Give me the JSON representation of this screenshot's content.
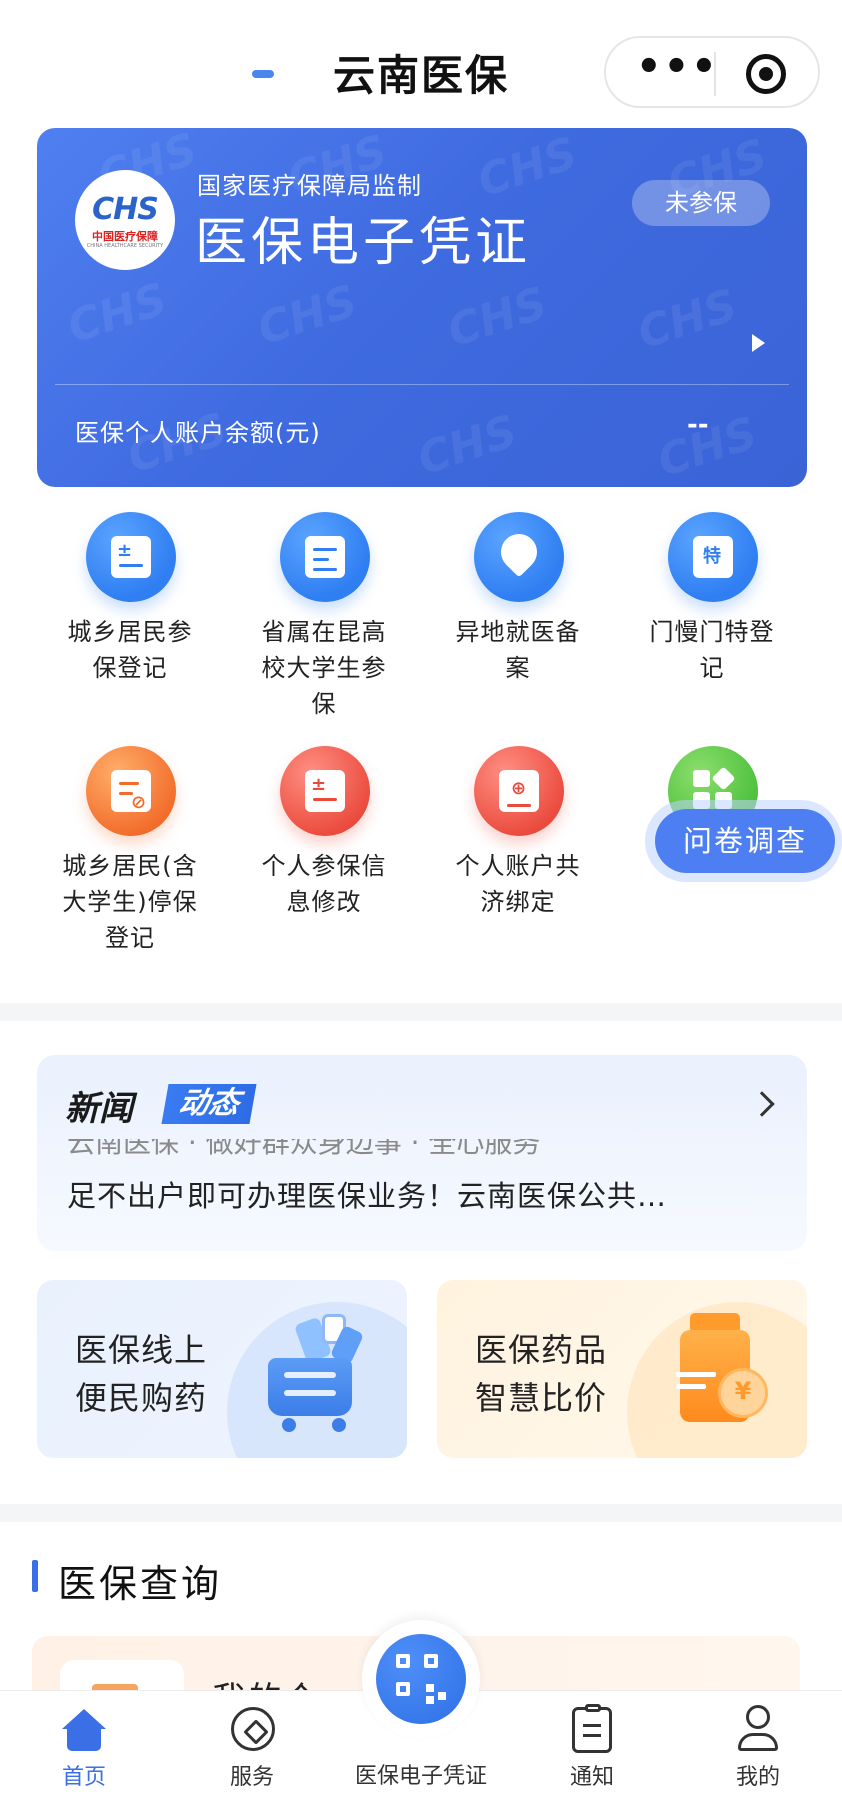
{
  "header": {
    "title": "云南医保",
    "more_icon": "more-dots-icon",
    "close_icon": "target-icon"
  },
  "card": {
    "logo_text": "CHS",
    "logo_cn": "中国医疗保障",
    "logo_en": "CHINA HEALTHCARE SECURITY",
    "subtitle": "国家医疗保障局监制",
    "title": "医保电子凭证",
    "badge": "未参保",
    "balance_label": "医保个人账户余额(元)",
    "balance_value": "--",
    "watermark": "CHS",
    "colors": {
      "start": "#4f7ff0",
      "end": "#3a63d6"
    }
  },
  "services": [
    {
      "label": "城乡居民参保登记",
      "lines": [
        "城乡居民参",
        "保登记"
      ],
      "icon": "form-edit-icon",
      "color": "blue"
    },
    {
      "label": "省属在昆高校大学生参保",
      "lines": [
        "省属在昆高",
        "校大学生参",
        "保"
      ],
      "icon": "student-card-icon",
      "color": "blue"
    },
    {
      "label": "异地就医备案",
      "lines": [
        "异地就医备",
        "案"
      ],
      "icon": "location-pin-icon",
      "color": "blue"
    },
    {
      "label": "门慢门特登记",
      "lines": [
        "门慢门特登",
        "记"
      ],
      "icon": "calendar-special-icon",
      "color": "blue",
      "icon_text": "特"
    },
    {
      "label": "城乡居民(含大学生)停保登记",
      "lines": [
        "城乡居民(含",
        "大学生)停保",
        "登记"
      ],
      "icon": "stop-insurance-icon",
      "color": "orange"
    },
    {
      "label": "个人参保信息修改",
      "lines": [
        "个人参保信",
        "息修改"
      ],
      "icon": "edit-info-icon",
      "color": "red"
    },
    {
      "label": "个人账户共济绑定",
      "lines": [
        "个人账户共",
        "济绑定"
      ],
      "icon": "account-bind-icon",
      "color": "red"
    },
    {
      "label": "",
      "lines": [],
      "icon": "more-apps-icon",
      "color": "green"
    }
  ],
  "survey": {
    "label": "问卷调查"
  },
  "news": {
    "head_a": "新闻",
    "head_b": "动态",
    "ghost": "云南医保 · 做好群众身边事 · 全心服务",
    "text": "足不出户即可办理医保业务！云南医保公共…"
  },
  "promos": [
    {
      "line1": "医保线上",
      "line2": "便民购药",
      "icon": "shopping-cart-icon"
    },
    {
      "line1": "医保药品",
      "line2": "智慧比价",
      "icon": "medicine-bottle-icon"
    }
  ],
  "section": {
    "title": "医保查询",
    "peek_text": "我的个"
  },
  "tabbar": {
    "tabs": [
      {
        "label": "首页",
        "icon": "home-icon",
        "active": true
      },
      {
        "label": "服务",
        "icon": "compass-icon",
        "active": false
      },
      {
        "label": "医保电子凭证",
        "icon": "qr-code-icon",
        "active": false
      },
      {
        "label": "通知",
        "icon": "clipboard-icon",
        "active": false
      },
      {
        "label": "我的",
        "icon": "user-icon",
        "active": false
      }
    ],
    "active_color": "#3a6fe6"
  }
}
